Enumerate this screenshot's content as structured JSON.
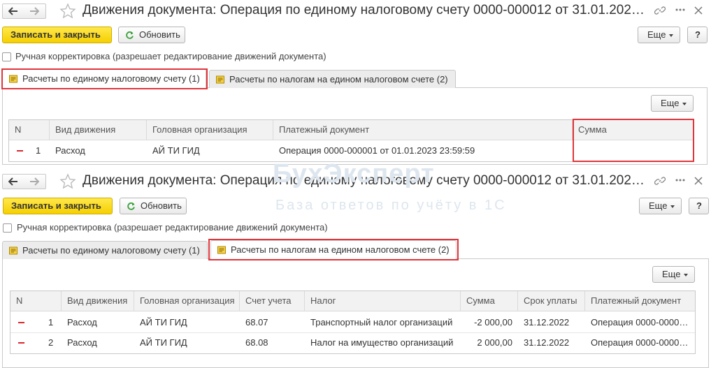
{
  "watermark": {
    "brand": "БухЭксперт",
    "tagline": "База ответов по учёту в 1С"
  },
  "window1": {
    "title": "Движения документа: Операция по единому налоговому счету 0000-000012 от 31.01.202…",
    "save_close_label": "Записать и закрыть",
    "refresh_label": "Обновить",
    "more_label": "Еще",
    "help_label": "?",
    "manual_edit_label": "Ручная корректировка (разрешает редактирование движений документа)",
    "tabs": [
      {
        "label": "Расчеты по единому налоговому счету (1)",
        "active": true
      },
      {
        "label": "Расчеты по налогам на едином налоговом счете (2)",
        "active": false
      }
    ],
    "panel_more_label": "Еще",
    "columns": [
      "N",
      "Вид движения",
      "Головная организация",
      "Платежный документ",
      "Сумма"
    ],
    "rows": [
      {
        "n": "1",
        "kind": "Расход",
        "org": "АЙ ТИ ГИД",
        "doc": "Операция 0000-000001 от 01.01.2023 23:59:59",
        "sum": ""
      }
    ]
  },
  "window2": {
    "title": "Движения документа: Операция по единому налоговому счету 0000-000012 от 31.01.202…",
    "save_close_label": "Записать и закрыть",
    "refresh_label": "Обновить",
    "more_label": "Еще",
    "help_label": "?",
    "manual_edit_label": "Ручная корректировка (разрешает редактирование движений документа)",
    "tabs": [
      {
        "label": "Расчеты по единому налоговому счету (1)",
        "active": false
      },
      {
        "label": "Расчеты по налогам на едином налоговом счете (2)",
        "active": true
      }
    ],
    "panel_more_label": "Еще",
    "columns": [
      "N",
      "Вид движения",
      "Головная организация",
      "Счет учета",
      "Налог",
      "Сумма",
      "Срок уплаты",
      "Платежный документ"
    ],
    "rows": [
      {
        "n": "1",
        "kind": "Расход",
        "org": "АЙ ТИ ГИД",
        "account": "68.07",
        "tax": "Транспортный налог организаций",
        "sum": "-2 000,00",
        "due": "31.12.2022",
        "doc": "Операция 0000-0000…"
      },
      {
        "n": "2",
        "kind": "Расход",
        "org": "АЙ ТИ ГИД",
        "account": "68.08",
        "tax": "Налог на имущество организаций",
        "sum": "2 000,00",
        "due": "31.12.2022",
        "doc": "Операция 0000-0000…"
      }
    ]
  },
  "colors": {
    "primary_button": "#f5cf00",
    "highlight_box": "#e0353b",
    "expense_marker": "#d9262c"
  }
}
